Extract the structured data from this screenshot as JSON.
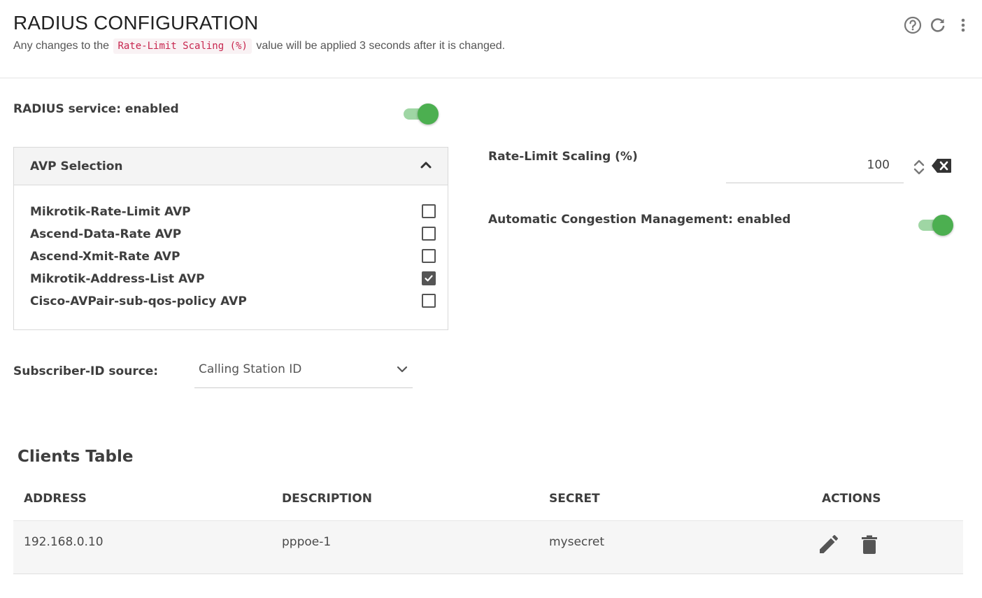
{
  "header": {
    "title": "RADIUS CONFIGURATION",
    "subtitle_before": "Any changes to the",
    "subtitle_code": "Rate-Limit Scaling (%)",
    "subtitle_after": "value will be applied 3 seconds after it is changed.",
    "icons": [
      "help-icon",
      "refresh-icon",
      "more-vert-icon"
    ]
  },
  "radius_service": {
    "label": "RADIUS service: enabled",
    "enabled": true
  },
  "avp_selection": {
    "title": "AVP Selection",
    "expanded": true,
    "items": [
      {
        "label": "Mikrotik-Rate-Limit AVP",
        "checked": false
      },
      {
        "label": "Ascend-Data-Rate AVP",
        "checked": false
      },
      {
        "label": "Ascend-Xmit-Rate AVP",
        "checked": false
      },
      {
        "label": "Mikrotik-Address-List AVP",
        "checked": true
      },
      {
        "label": "Cisco-AVPair-sub-qos-policy AVP",
        "checked": false
      }
    ]
  },
  "rate_limit": {
    "label": "Rate-Limit Scaling (%)",
    "value": "100"
  },
  "congestion": {
    "label": "Automatic Congestion Management: enabled",
    "enabled": true
  },
  "subscriber_id": {
    "label": "Subscriber-ID source:",
    "value": "Calling Station ID"
  },
  "clients_table": {
    "title": "Clients Table",
    "columns": [
      "ADDRESS",
      "DESCRIPTION",
      "SECRET",
      "ACTIONS"
    ],
    "rows": [
      {
        "address": "192.168.0.10",
        "description": "pppoe-1",
        "secret": "mysecret"
      }
    ]
  },
  "colors": {
    "accent_green": "#4caf50",
    "toggle_track": "#9fd6a4",
    "code_text": "#c7254e"
  }
}
